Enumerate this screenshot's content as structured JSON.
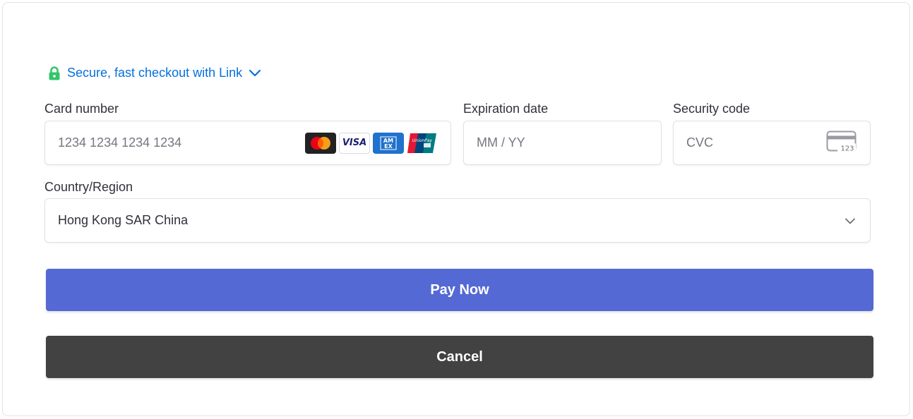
{
  "link": {
    "text": "Secure, fast checkout with Link",
    "color": "#0570de",
    "lock_color": "#32c56a"
  },
  "card_number": {
    "label": "Card number",
    "placeholder": "1234 1234 1234 1234",
    "brands": [
      "mastercard-icon",
      "visa-icon",
      "amex-icon",
      "unionpay-icon"
    ]
  },
  "expiration": {
    "label": "Expiration date",
    "placeholder": "MM / YY"
  },
  "security": {
    "label": "Security code",
    "placeholder": "CVC"
  },
  "country": {
    "label": "Country/Region",
    "value": "Hong Kong SAR China"
  },
  "buttons": {
    "pay_label": "Pay Now",
    "pay_color": "#5469d4",
    "cancel_label": "Cancel",
    "cancel_color": "#424242"
  }
}
